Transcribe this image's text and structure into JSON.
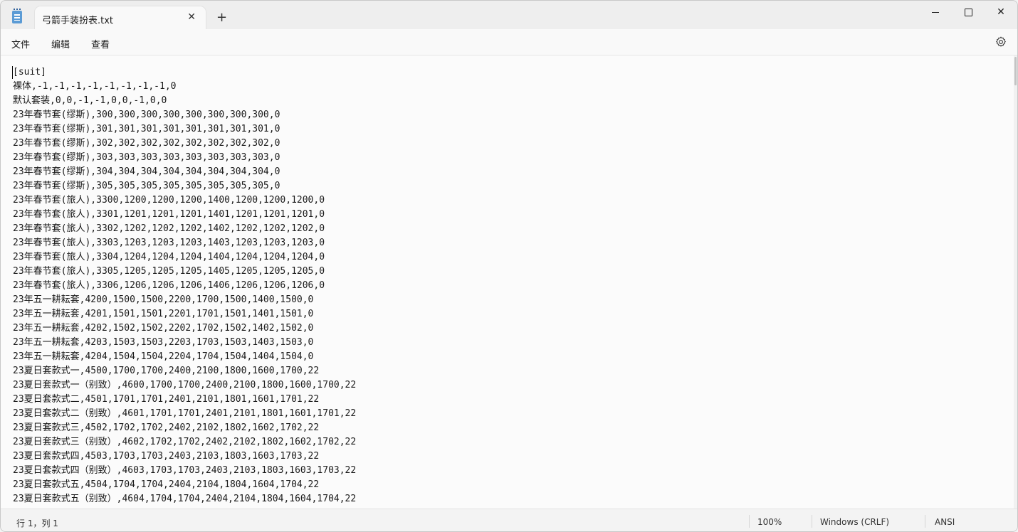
{
  "tab": {
    "title": "弓箭手装扮表.txt",
    "close": "✕",
    "new": "+"
  },
  "window_controls": {
    "close": "✕"
  },
  "menu": {
    "file": "文件",
    "edit": "编辑",
    "view": "查看"
  },
  "icons": {
    "app": "notepad-icon",
    "settings": "gear-icon",
    "minimize": "minimize-icon",
    "maximize": "maximize-icon",
    "close": "close-icon"
  },
  "editor": {
    "lines": [
      "[suit]",
      "裸体,-1,-1,-1,-1,-1,-1,-1,-1,0",
      "默认套装,0,0,-1,-1,0,0,-1,0,0",
      "23年春节套(缪斯),300,300,300,300,300,300,300,300,0",
      "23年春节套(缪斯),301,301,301,301,301,301,301,301,0",
      "23年春节套(缪斯),302,302,302,302,302,302,302,302,0",
      "23年春节套(缪斯),303,303,303,303,303,303,303,303,0",
      "23年春节套(缪斯),304,304,304,304,304,304,304,304,0",
      "23年春节套(缪斯),305,305,305,305,305,305,305,305,0",
      "23年春节套(旅人),3300,1200,1200,1200,1400,1200,1200,1200,0",
      "23年春节套(旅人),3301,1201,1201,1201,1401,1201,1201,1201,0",
      "23年春节套(旅人),3302,1202,1202,1202,1402,1202,1202,1202,0",
      "23年春节套(旅人),3303,1203,1203,1203,1403,1203,1203,1203,0",
      "23年春节套(旅人),3304,1204,1204,1204,1404,1204,1204,1204,0",
      "23年春节套(旅人),3305,1205,1205,1205,1405,1205,1205,1205,0",
      "23年春节套(旅人),3306,1206,1206,1206,1406,1206,1206,1206,0",
      "23年五一耕耘套,4200,1500,1500,2200,1700,1500,1400,1500,0",
      "23年五一耕耘套,4201,1501,1501,2201,1701,1501,1401,1501,0",
      "23年五一耕耘套,4202,1502,1502,2202,1702,1502,1402,1502,0",
      "23年五一耕耘套,4203,1503,1503,2203,1703,1503,1403,1503,0",
      "23年五一耕耘套,4204,1504,1504,2204,1704,1504,1404,1504,0",
      "23夏日套款式一,4500,1700,1700,2400,2100,1800,1600,1700,22",
      "23夏日套款式一（别致）,4600,1700,1700,2400,2100,1800,1600,1700,22",
      "23夏日套款式二,4501,1701,1701,2401,2101,1801,1601,1701,22",
      "23夏日套款式二（别致）,4601,1701,1701,2401,2101,1801,1601,1701,22",
      "23夏日套款式三,4502,1702,1702,2402,2102,1802,1602,1702,22",
      "23夏日套款式三（别致）,4602,1702,1702,2402,2102,1802,1602,1702,22",
      "23夏日套款式四,4503,1703,1703,2403,2103,1803,1603,1703,22",
      "23夏日套款式四（别致）,4603,1703,1703,2403,2103,1803,1603,1703,22",
      "23夏日套款式五,4504,1704,1704,2404,2104,1804,1604,1704,22",
      "23夏日套款式五（别致）,4604,1704,1704,2404,2104,1804,1604,1704,22"
    ]
  },
  "status": {
    "position": "行 1，列 1",
    "zoom": "100%",
    "line_ending": "Windows (CRLF)",
    "encoding": "ANSI"
  }
}
